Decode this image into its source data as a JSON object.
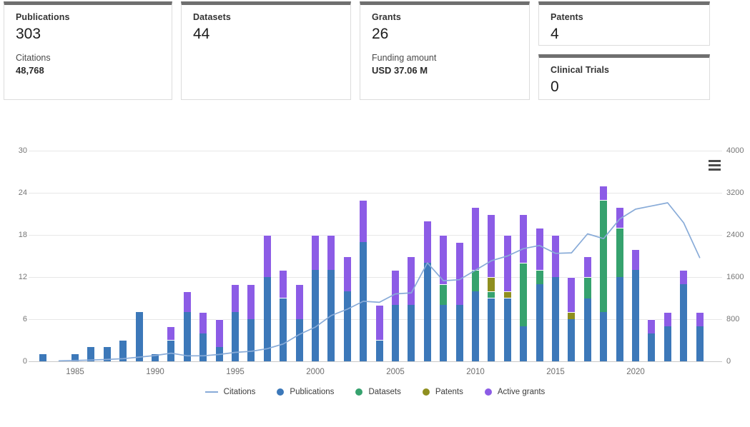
{
  "cards": {
    "publications": {
      "label": "Publications",
      "value": "303",
      "sub_label": "Citations",
      "sub_value": "48,768"
    },
    "datasets": {
      "label": "Datasets",
      "value": "44"
    },
    "grants": {
      "label": "Grants",
      "value": "26",
      "sub_label": "Funding amount",
      "sub_value": "USD 37.06 M"
    },
    "patents": {
      "label": "Patents",
      "value": "4"
    },
    "clinical_trials": {
      "label": "Clinical Trials",
      "value": "0"
    }
  },
  "chart_data": {
    "type": "bar",
    "subtype": "stacked-bars-with-line-overlay",
    "x": [
      1983,
      1984,
      1985,
      1986,
      1987,
      1988,
      1989,
      1990,
      1991,
      1992,
      1993,
      1994,
      1995,
      1996,
      1997,
      1998,
      1999,
      2000,
      2001,
      2002,
      2003,
      2004,
      2005,
      2006,
      2007,
      2008,
      2009,
      2010,
      2011,
      2012,
      2013,
      2014,
      2015,
      2016,
      2017,
      2018,
      2019,
      2020,
      2021,
      2022,
      2023,
      2024
    ],
    "x_ticks": [
      1985,
      1990,
      1995,
      2000,
      2005,
      2010,
      2015,
      2020
    ],
    "left_axis": {
      "ticks": [
        0,
        6,
        12,
        18,
        24,
        30
      ],
      "max": 30,
      "applies_to": "bars"
    },
    "right_axis": {
      "ticks": [
        0,
        800,
        1600,
        2400,
        3200,
        4000
      ],
      "max": 4000,
      "applies_to": "Citations line"
    },
    "grid": true,
    "legend_position": "bottom-center",
    "series": [
      {
        "name": "Publications",
        "type": "bar",
        "color": "#3c78b9",
        "values": [
          1,
          0,
          1,
          2,
          2,
          3,
          7,
          1,
          3,
          7,
          4,
          2,
          7,
          6,
          12,
          9,
          6,
          13,
          13,
          10,
          17,
          3,
          8,
          8,
          14,
          8,
          8,
          10,
          9,
          9,
          5,
          11,
          12,
          6,
          9,
          7,
          12,
          13,
          4,
          5,
          11,
          5
        ]
      },
      {
        "name": "Datasets",
        "type": "bar",
        "color": "#36a26e",
        "values": [
          0,
          0,
          0,
          0,
          0,
          0,
          0,
          0,
          0,
          0,
          0,
          0,
          0,
          0,
          0,
          0,
          0,
          0,
          0,
          0,
          0,
          0,
          0,
          0,
          0,
          3,
          0,
          3,
          1,
          0,
          9,
          2,
          0,
          0,
          3,
          16,
          7,
          0,
          0,
          0,
          0,
          0
        ]
      },
      {
        "name": "Patents",
        "type": "bar",
        "color": "#8f8f1f",
        "values": [
          0,
          0,
          0,
          0,
          0,
          0,
          0,
          0,
          0,
          0,
          0,
          0,
          0,
          0,
          0,
          0,
          0,
          0,
          0,
          0,
          0,
          0,
          0,
          0,
          0,
          0,
          0,
          0,
          2,
          1,
          0,
          0,
          0,
          1,
          0,
          0,
          0,
          0,
          0,
          0,
          0,
          0
        ]
      },
      {
        "name": "Active grants",
        "type": "bar",
        "color": "#8c5ce6",
        "values": [
          0,
          0,
          0,
          0,
          0,
          0,
          0,
          0,
          2,
          3,
          3,
          4,
          4,
          5,
          6,
          4,
          5,
          5,
          5,
          5,
          6,
          5,
          5,
          7,
          6,
          7,
          9,
          9,
          9,
          8,
          7,
          6,
          6,
          5,
          3,
          2,
          3,
          3,
          2,
          2,
          2,
          2
        ]
      },
      {
        "name": "Citations",
        "type": "line",
        "axis": "right",
        "color": "#88abd8",
        "values": [
          null,
          10,
          15,
          25,
          35,
          50,
          80,
          110,
          155,
          105,
          105,
          130,
          170,
          190,
          240,
          330,
          510,
          650,
          870,
          990,
          1140,
          1120,
          1280,
          1300,
          1870,
          1530,
          1550,
          1730,
          1910,
          2000,
          2140,
          2200,
          2050,
          2060,
          2420,
          2330,
          2700,
          2890,
          2950,
          3010,
          2630,
          1970
        ]
      }
    ],
    "legend": [
      {
        "label": "Citations",
        "swatch": "line",
        "color": "#88abd8"
      },
      {
        "label": "Publications",
        "swatch": "dot",
        "color": "#3c78b9"
      },
      {
        "label": "Datasets",
        "swatch": "dot",
        "color": "#36a26e"
      },
      {
        "label": "Patents",
        "swatch": "dot",
        "color": "#8f8f1f"
      },
      {
        "label": "Active grants",
        "swatch": "dot",
        "color": "#8c5ce6"
      }
    ]
  },
  "icons": {
    "chart_menu": "hamburger-menu"
  }
}
